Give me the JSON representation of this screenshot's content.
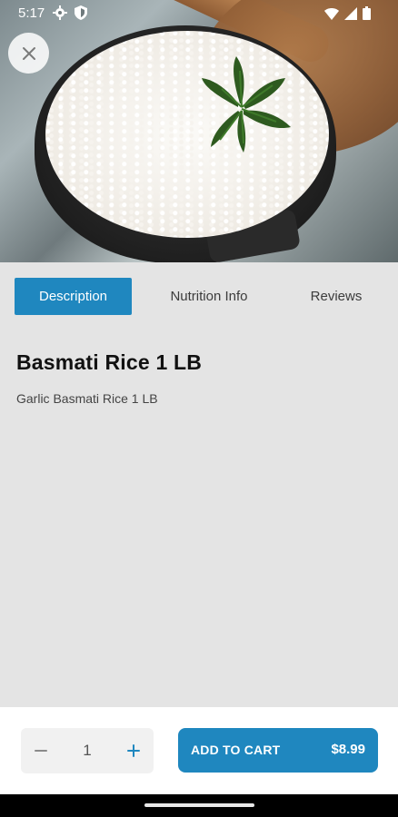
{
  "status_bar": {
    "time": "5:17",
    "left_icons": [
      "gear-icon",
      "shield-icon"
    ],
    "right_icons": [
      "wifi-icon",
      "signal-icon",
      "battery-icon"
    ]
  },
  "hero": {
    "image": "basmati-rice-bowl-image"
  },
  "tabs": [
    {
      "label": "Description",
      "active": true
    },
    {
      "label": "Nutrition Info",
      "active": false
    },
    {
      "label": "Reviews",
      "active": false
    }
  ],
  "product": {
    "title": "Basmati Rice 1 LB",
    "description": "Garlic Basmati Rice 1 LB"
  },
  "cart": {
    "quantity": "1",
    "add_label": "ADD TO CART",
    "price": "$8.99"
  },
  "colors": {
    "accent": "#1f87bf",
    "background": "#e4e4e4",
    "bottom_bar": "#ffffff"
  }
}
